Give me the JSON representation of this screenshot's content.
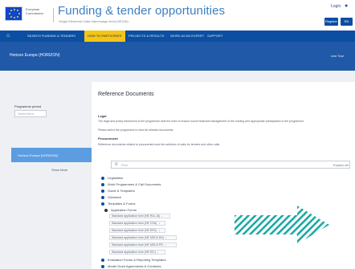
{
  "header": {
    "logo_text": "European Commission",
    "title": "Funding & tender opportunities",
    "subtitle": "Single Electronic Data Interchange Area (SEDIA)",
    "login": "Login",
    "register": "Register",
    "language": "EN"
  },
  "nav": {
    "items": [
      {
        "label": "SEARCH FUNDING & TENDERS"
      },
      {
        "label": "HOW TO PARTICIPATE"
      },
      {
        "label": "PROJECTS & RESULTS"
      },
      {
        "label": "WORK AS AN EXPERT"
      },
      {
        "label": "SUPPORT"
      }
    ],
    "active_index": 1
  },
  "banner": {
    "title": "Horizon Europe (HORIZON)",
    "link": "Live Tool"
  },
  "sidebar": {
    "filter_label": "Programme period",
    "search_placeholder": "Select item",
    "active_item": "Horizon Europe (HORIZON)",
    "show_more": "Show More"
  },
  "main": {
    "title": "Reference Documents",
    "sections": [
      {
        "heading": "Legal",
        "lines": [
          "The legal and policy framework of the programme sets the rules to ensure sound financial management of the funding and appropriate participation in the programme.",
          "Please select the programme to view all relevant documents."
        ]
      },
      {
        "heading": "Procurement",
        "lines": [
          "Reference documents related to procurement and the selection of calls for tenders and other calls."
        ]
      }
    ],
    "tree_search_placeholder": "Find",
    "tree_expand": "Expand all",
    "tree": [
      {
        "label": "Legislation",
        "level": 0
      },
      {
        "label": "Work Programmes & Call Documents",
        "level": 0
      },
      {
        "label": "Guide & Templates",
        "level": 0
      },
      {
        "label": "Guidance",
        "level": 0
      },
      {
        "label": "Templates & Forms",
        "level": 0
      },
      {
        "label": "Application Forms",
        "level": 1
      }
    ],
    "leaves": [
      {
        "label": "Standard application form (HE RIA, IA)"
      },
      {
        "label": "Standard application form (HE CSA)"
      },
      {
        "label": "Standard application form (HE ERC)"
      },
      {
        "label": "Standard application form (HE MSCA DN)"
      },
      {
        "label": "Standard application form (HE MSCA PF)"
      },
      {
        "label": "Standard application form (HE EIC)"
      }
    ],
    "tail": [
      {
        "label": "Evaluation Forms & Reporting Templates"
      },
      {
        "label": "Model Grant Agreements & Contracts"
      }
    ]
  },
  "colors": {
    "primary": "#0b4ea2",
    "banner": "#1f59a8",
    "active_nav": "#f5c518",
    "sidebar_active": "#5b9de0",
    "decor_arrow": "#1ba9a3"
  }
}
